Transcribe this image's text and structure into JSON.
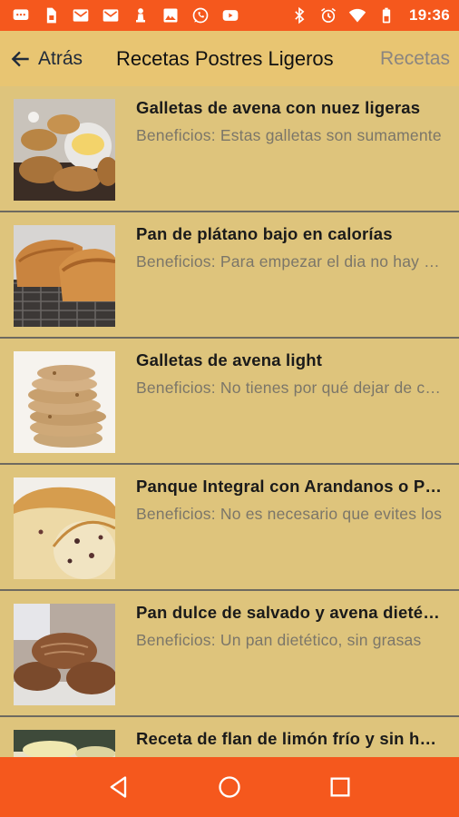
{
  "status_bar": {
    "time": "19:36",
    "left_icons": [
      "chat-icon",
      "sim-icon",
      "gmail-icon",
      "gmail-icon",
      "chess-pawn-icon",
      "image-icon",
      "whatsapp-icon",
      "youtube-icon"
    ],
    "right_icons": [
      "bluetooth-icon",
      "alarm-icon",
      "wifi-icon",
      "battery-icon"
    ]
  },
  "app_bar": {
    "back_label": "Atrás",
    "title": "Recetas Postres Ligeros",
    "action_label": "Recetas"
  },
  "recipes": [
    {
      "title": "Galletas de avena con nuez ligeras",
      "description": "Beneficios:  Estas galletas son sumamente"
    },
    {
      "title": "Pan de plátano bajo en calorías",
      "description": "Beneficios: Para empezar el dia no hay nada"
    },
    {
      "title": "Galletas de avena light",
      "description": "Beneficios: No tienes por qué dejar de comer"
    },
    {
      "title": "Panque Integral con Arandanos o Pasas",
      "description": "Beneficios: No es necesario que evites los"
    },
    {
      "title": "Pan dulce de salvado y avena dietético",
      "description": "Beneficios: Un pan dietético, sin grasas"
    },
    {
      "title": "Receta de flan de limón frío y sin horno",
      "description": ""
    }
  ],
  "nav_bar": {
    "buttons": [
      "back-triangle-icon",
      "home-circle-icon",
      "recents-square-icon"
    ]
  },
  "colors": {
    "accent": "#f5581d",
    "app_bar": "#e8c572",
    "list_bg": "#dec47c",
    "divider": "#6e6a60"
  }
}
